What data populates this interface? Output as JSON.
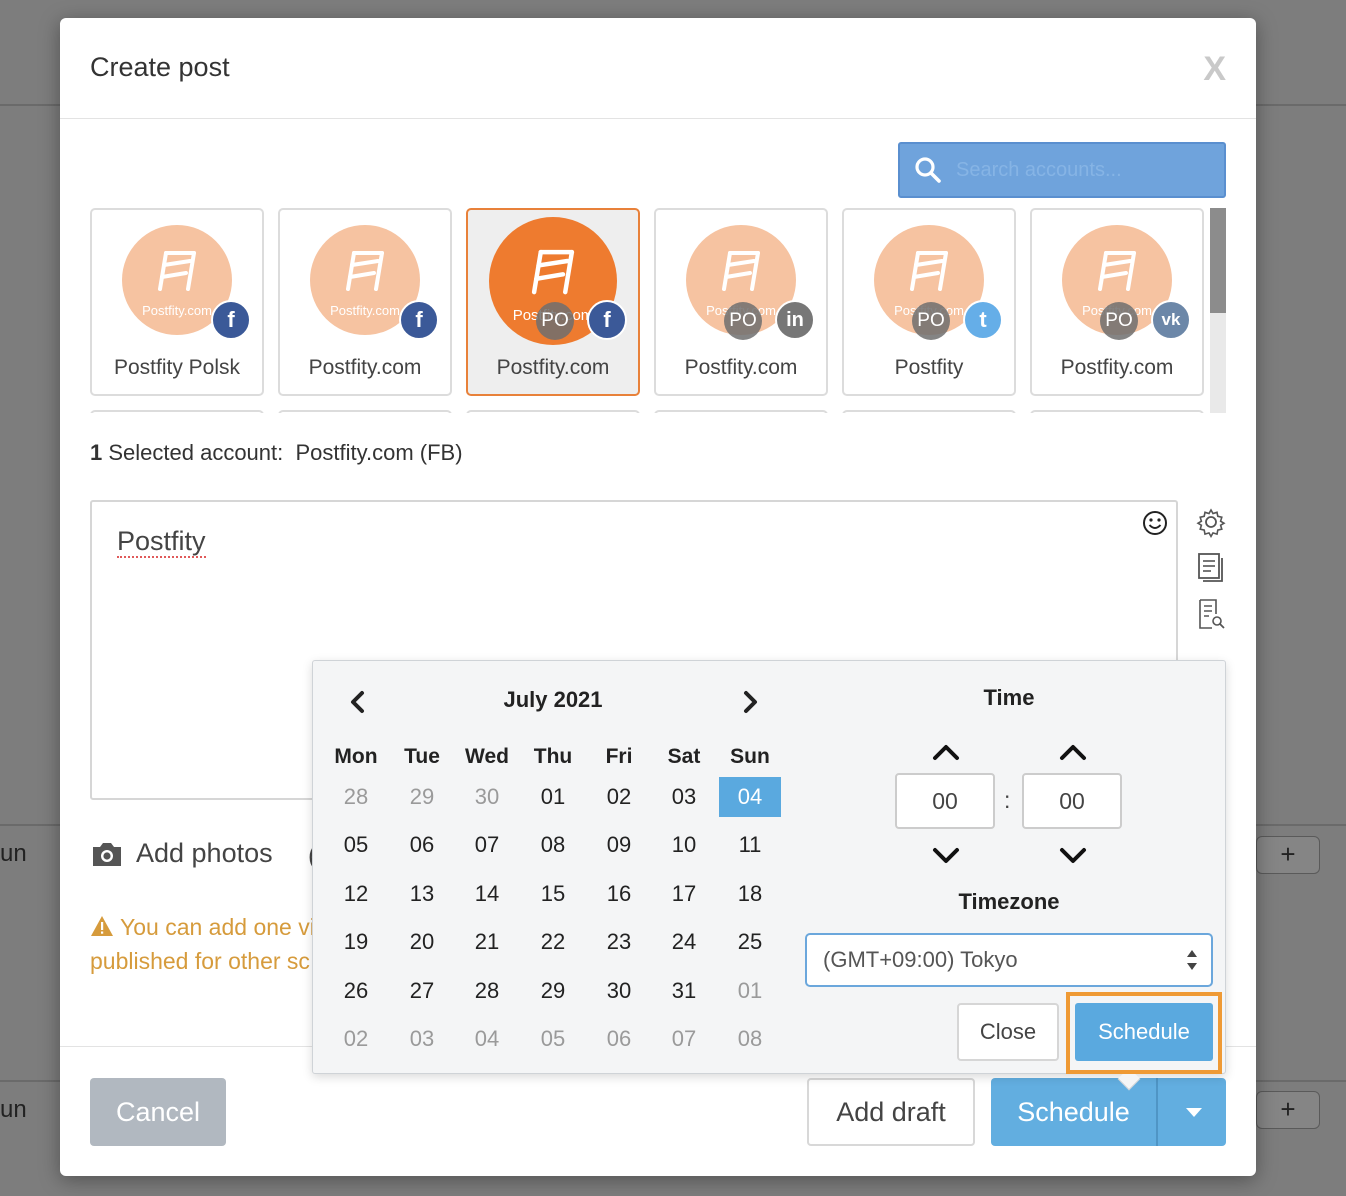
{
  "background": {
    "left_texts": [
      "un",
      "un"
    ],
    "plus_label": "+"
  },
  "modal": {
    "title": "Create post",
    "close_label": "X",
    "search_placeholder": "Search accounts..."
  },
  "accounts": [
    {
      "name": "Postfity Polsk",
      "brand": "Postfity.com",
      "network": "facebook",
      "network_glyph": "f",
      "po": "",
      "selected": false
    },
    {
      "name": "Postfity.com",
      "brand": "Postfity.com",
      "network": "facebook",
      "network_glyph": "f",
      "po": "",
      "selected": false
    },
    {
      "name": "Postfity.com",
      "brand": "Postfity.com",
      "network": "facebook",
      "network_glyph": "f",
      "po": "PO",
      "selected": true
    },
    {
      "name": "Postfity.com",
      "brand": "Postfity.com",
      "network": "linkedin",
      "network_glyph": "in",
      "po": "PO",
      "selected": false
    },
    {
      "name": "Postfity",
      "brand": "Postfity.com",
      "network": "twitter",
      "network_glyph": "t",
      "po": "PO",
      "selected": false
    },
    {
      "name": "Postfity.com",
      "brand": "Postfity.com",
      "network": "vk",
      "network_glyph": "vk",
      "po": "PO",
      "selected": false
    }
  ],
  "selection": {
    "count": "1",
    "label": " Selected account:",
    "value": "Postfity.com (FB)"
  },
  "editor": {
    "text": "Postfity"
  },
  "media": {
    "add_photos": "Add photos"
  },
  "warning": {
    "line1": "You can add one vi",
    "line2": "published for other sc"
  },
  "footer": {
    "cancel": "Cancel",
    "add_draft": "Add draft",
    "schedule": "Schedule"
  },
  "calendar": {
    "month_label": "July 2021",
    "weekdays": [
      "Mon",
      "Tue",
      "Wed",
      "Thu",
      "Fri",
      "Sat",
      "Sun"
    ],
    "weeks": [
      [
        [
          "28",
          "muted"
        ],
        [
          "29",
          "muted"
        ],
        [
          "30",
          "muted"
        ],
        [
          "01",
          ""
        ],
        [
          "02",
          ""
        ],
        [
          "03",
          ""
        ],
        [
          "04",
          "active"
        ]
      ],
      [
        [
          "05",
          ""
        ],
        [
          "06",
          ""
        ],
        [
          "07",
          ""
        ],
        [
          "08",
          ""
        ],
        [
          "09",
          ""
        ],
        [
          "10",
          ""
        ],
        [
          "11",
          ""
        ]
      ],
      [
        [
          "12",
          ""
        ],
        [
          "13",
          ""
        ],
        [
          "14",
          ""
        ],
        [
          "15",
          ""
        ],
        [
          "16",
          ""
        ],
        [
          "17",
          ""
        ],
        [
          "18",
          ""
        ]
      ],
      [
        [
          "19",
          ""
        ],
        [
          "20",
          ""
        ],
        [
          "21",
          ""
        ],
        [
          "22",
          ""
        ],
        [
          "23",
          ""
        ],
        [
          "24",
          ""
        ],
        [
          "25",
          ""
        ]
      ],
      [
        [
          "26",
          ""
        ],
        [
          "27",
          ""
        ],
        [
          "28",
          ""
        ],
        [
          "29",
          ""
        ],
        [
          "30",
          ""
        ],
        [
          "31",
          ""
        ],
        [
          "01",
          "muted"
        ]
      ],
      [
        [
          "02",
          "muted"
        ],
        [
          "03",
          "muted"
        ],
        [
          "04",
          "muted"
        ],
        [
          "05",
          "muted"
        ],
        [
          "06",
          "muted"
        ],
        [
          "07",
          "muted"
        ],
        [
          "08",
          "muted"
        ]
      ]
    ]
  },
  "time": {
    "title": "Time",
    "hours": "00",
    "minutes": "00",
    "separator": ":",
    "timezone_title": "Timezone",
    "timezone_value": "(GMT+09:00) Tokyo",
    "close_label": "Close",
    "schedule_label": "Schedule"
  },
  "colors": {
    "accent_blue": "#62aee0",
    "selected_orange": "#e8813a",
    "highlight_orange": "#ef9a35",
    "warning": "#d69b3c",
    "facebook": "#3b5998",
    "linkedin": "#777777",
    "twitter": "#65aee8",
    "vk": "#6c87a8"
  }
}
